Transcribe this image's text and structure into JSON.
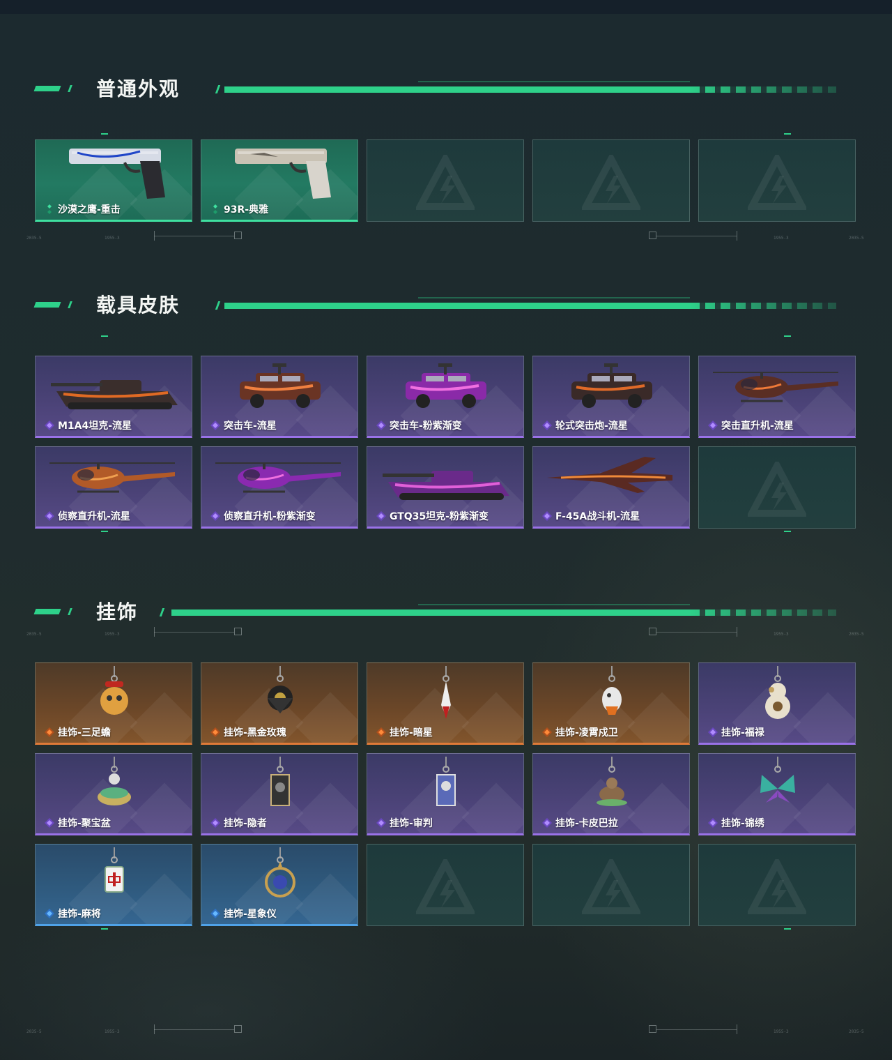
{
  "colors": {
    "accent_green": "#2ed18a",
    "rarity_green": "#3fe0a0",
    "rarity_purple": "#9a72e8",
    "rarity_orange": "#e07a38",
    "rarity_blue": "#4fa2e8"
  },
  "deco_labels": [
    "2035-5",
    "1955-3"
  ],
  "sections": [
    {
      "title": "普通外观",
      "items": [
        {
          "label": "沙漠之鹰-重击",
          "rarity": "green",
          "icon": "pistol-desert-eagle"
        },
        {
          "label": "93R-典雅",
          "rarity": "green",
          "icon": "pistol-93r"
        },
        {
          "label": "",
          "rarity": "empty"
        },
        {
          "label": "",
          "rarity": "empty"
        },
        {
          "label": "",
          "rarity": "empty"
        }
      ]
    },
    {
      "title": "载具皮肤",
      "items": [
        {
          "label": "M1A4坦克-流星",
          "rarity": "purple",
          "icon": "tank"
        },
        {
          "label": "突击车-流星",
          "rarity": "purple",
          "icon": "assault-vehicle"
        },
        {
          "label": "突击车-粉紫渐变",
          "rarity": "purple",
          "icon": "assault-vehicle-pink"
        },
        {
          "label": "轮式突击炮-流星",
          "rarity": "purple",
          "icon": "wheeled-assault-gun"
        },
        {
          "label": "突击直升机-流星",
          "rarity": "purple",
          "icon": "attack-helicopter"
        },
        {
          "label": "侦察直升机-流星",
          "rarity": "purple",
          "icon": "scout-helicopter"
        },
        {
          "label": "侦察直升机-粉紫渐变",
          "rarity": "purple",
          "icon": "scout-helicopter-pink"
        },
        {
          "label": "GTQ35坦克-粉紫渐变",
          "rarity": "purple",
          "icon": "tank-pink"
        },
        {
          "label": "F-45A战斗机-流星",
          "rarity": "purple",
          "icon": "fighter-jet"
        },
        {
          "label": "",
          "rarity": "empty"
        }
      ]
    },
    {
      "title": "挂饰",
      "items": [
        {
          "label": "挂饰-三足蟾",
          "rarity": "orange",
          "icon": "charm-toad"
        },
        {
          "label": "挂饰-黑金玫瑰",
          "rarity": "orange",
          "icon": "charm-rose"
        },
        {
          "label": "挂饰-暗星",
          "rarity": "orange",
          "icon": "charm-dark-star"
        },
        {
          "label": "挂饰-凌霄戍卫",
          "rarity": "orange",
          "icon": "charm-guard"
        },
        {
          "label": "挂饰-福禄",
          "rarity": "purple",
          "icon": "charm-gourd"
        },
        {
          "label": "挂饰-聚宝盆",
          "rarity": "purple",
          "icon": "charm-treasure-bowl"
        },
        {
          "label": "挂饰-隐者",
          "rarity": "purple",
          "icon": "charm-hermit-card"
        },
        {
          "label": "挂饰-审判",
          "rarity": "purple",
          "icon": "charm-judgement-card"
        },
        {
          "label": "挂饰-卡皮巴拉",
          "rarity": "purple",
          "icon": "charm-capybara"
        },
        {
          "label": "挂饰-锦绣",
          "rarity": "purple",
          "icon": "charm-butterfly"
        },
        {
          "label": "挂饰-麻将",
          "rarity": "blue",
          "icon": "charm-mahjong"
        },
        {
          "label": "挂饰-星象仪",
          "rarity": "blue",
          "icon": "charm-astrolabe"
        },
        {
          "label": "",
          "rarity": "empty"
        },
        {
          "label": "",
          "rarity": "empty"
        },
        {
          "label": "",
          "rarity": "empty"
        }
      ]
    }
  ]
}
